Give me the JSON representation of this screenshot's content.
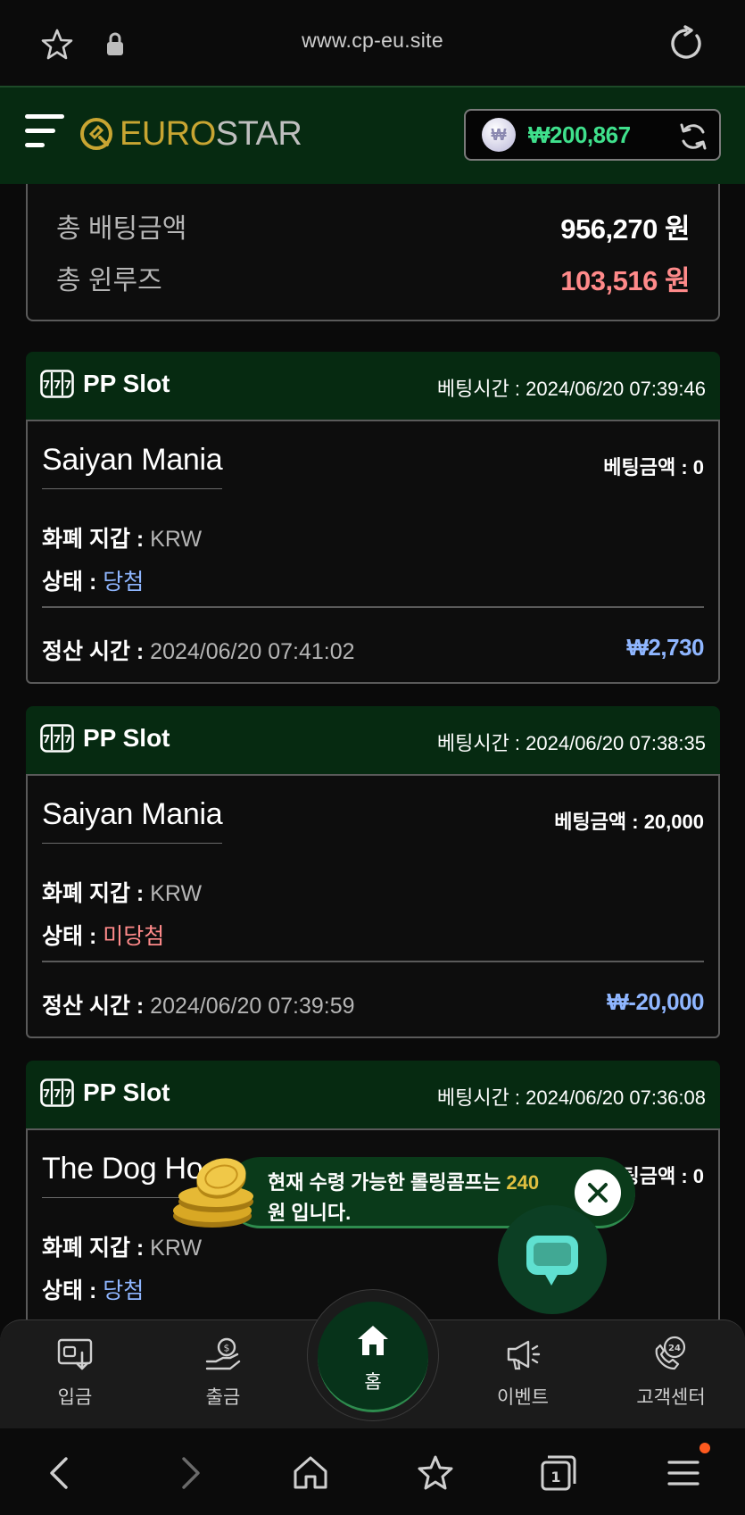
{
  "browser": {
    "url": "www.cp-eu.site",
    "icons": [
      "star-icon",
      "lock-icon",
      "reload-icon"
    ]
  },
  "header": {
    "logo_part1": "EURO",
    "logo_part2": "STAR",
    "currency_symbol": "₩",
    "balance": "₩200,867",
    "colors": {
      "header_bg": "#062a11",
      "balance": "#3fe08c",
      "logo_gold": "#c8a532"
    }
  },
  "summary": {
    "total_bet_label": "총 배팅금액",
    "total_bet_value": "956,270 원",
    "total_winloss_label": "총 윈루즈",
    "total_winloss_value": "103,516 원"
  },
  "bets": [
    {
      "provider": "PP Slot",
      "bet_time": "베팅시간 : 2024/06/20 07:39:46",
      "game": "Saiyan Mania",
      "bet_amount": "베팅금액 : 0",
      "currency_label": "화폐 지갑 : ",
      "currency_value": "KRW",
      "status_label": "상태 : ",
      "status_value": "당첨",
      "settle_label": "정산 시간 : ",
      "settle_value": "2024/06/20 07:41:02",
      "settle_amount": "₩2,730"
    },
    {
      "provider": "PP Slot",
      "bet_time": "베팅시간 : 2024/06/20 07:38:35",
      "game": "Saiyan Mania",
      "bet_amount": "베팅금액 : 20,000",
      "currency_label": "화폐 지갑 : ",
      "currency_value": "KRW",
      "status_label": "상태 : ",
      "status_value": "미당첨",
      "settle_label": "정산 시간 : ",
      "settle_value": "2024/06/20 07:39:59",
      "settle_amount": "₩-20,000"
    },
    {
      "provider": "PP Slot",
      "bet_time": "베팅시간 : 2024/06/20 07:36:08",
      "game": "The Dog Ho",
      "bet_amount": "팅금액 : 0",
      "currency_label": "화폐 지갑 : ",
      "currency_value": "KRW",
      "status_label": "상태 : ",
      "status_value": "당첨"
    }
  ],
  "toast": {
    "text_before": "현재 수령 가능한 롤링콤프는 ",
    "amount": "240",
    "text_after": " 원 입니다."
  },
  "bottom_nav": {
    "deposit": "입금",
    "withdraw": "출금",
    "home": "홈",
    "event": "이벤트",
    "support": "고객센터"
  },
  "system_bar": {
    "tab_count": "1",
    "icons": [
      "back-icon",
      "forward-icon",
      "home-icon",
      "bookmark-icon",
      "tabs-icon",
      "menu-icon"
    ]
  }
}
